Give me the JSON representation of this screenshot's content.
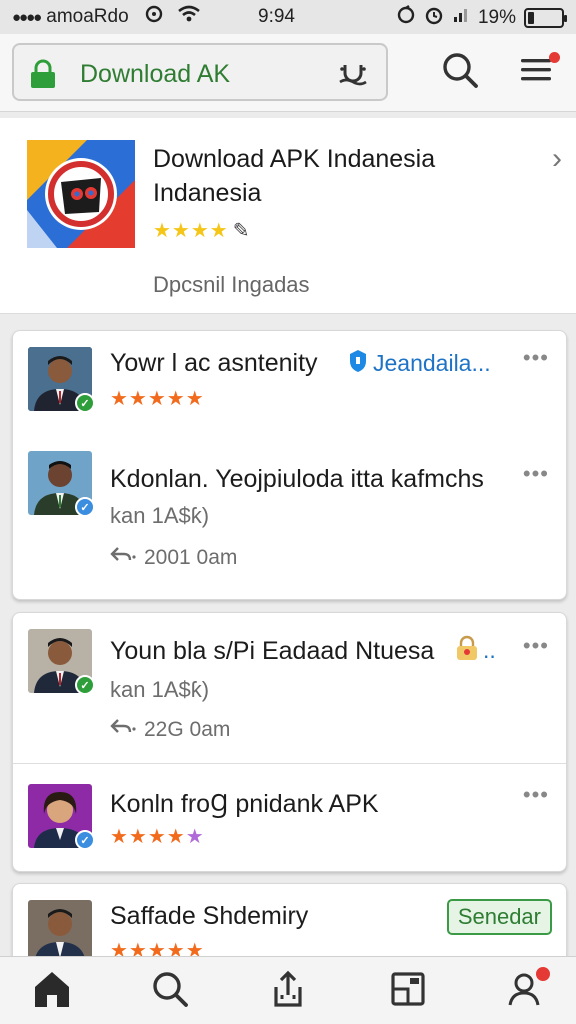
{
  "status_bar": {
    "carrier": "amoaRdo",
    "time": "9:94",
    "battery": "19%",
    "battery_level": 0.19
  },
  "address_bar": {
    "url_text": "Download AK"
  },
  "featured": {
    "title": "Download APK Indanesia Indanesia",
    "rating_stars": "★★★★",
    "rating_extra": "✎",
    "subtitle": "Dpcsnil Ingadas"
  },
  "card1": {
    "row1": {
      "name": "Yowr l ac asntenity",
      "link": "Jeandaila...",
      "stars": "★★★★★",
      "more": "•••"
    },
    "row2": {
      "name": "Kdonlan. Yeojpiuloda itta kafmchs",
      "meta": "kan 1A$ƙ)",
      "time": "2001 0am",
      "more": "•••"
    }
  },
  "card2": {
    "row1": {
      "name": "Youn bla s/Pi Eadaad Ntuesa",
      "link": "..",
      "meta": "kan 1A$ƙ)",
      "time": "22G 0am",
      "more": "•••"
    },
    "row2": {
      "name": "Konln froꞬ pnidank APK",
      "stars": "★★★★",
      "more": "•••"
    }
  },
  "card3": {
    "row1": {
      "name": "Saffade Shdemiry",
      "button": "Senedar",
      "stars": "★★★★★"
    }
  },
  "colors": {
    "accent_green": "#2e7d32",
    "link_blue": "#1e73c7",
    "star_orange": "#f26b1d",
    "star_gold": "#f5c518",
    "notification_red": "#e53935"
  }
}
